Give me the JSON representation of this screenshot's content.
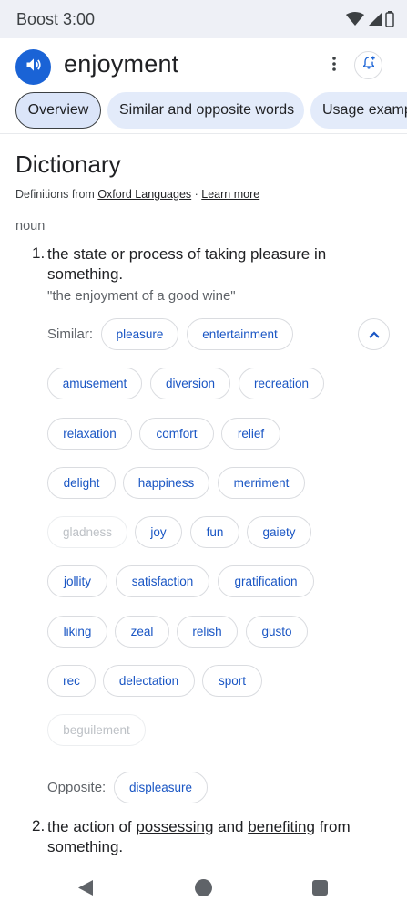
{
  "status_bar": {
    "carrier_time": "Boost 3:00",
    "icons": [
      "wifi-icon",
      "signal-icon",
      "battery-icon"
    ]
  },
  "header": {
    "word": "enjoyment",
    "speaker_icon": "speaker-icon",
    "more_icon": "more-vert-icon",
    "alert_icon": "bell-add-icon"
  },
  "tabs": [
    {
      "label": "Overview",
      "active": true
    },
    {
      "label": "Similar and opposite words",
      "active": false
    },
    {
      "label": "Usage examples",
      "active": false
    }
  ],
  "dictionary": {
    "heading": "Dictionary",
    "source_prefix": "Definitions from ",
    "source_link": "Oxford Languages",
    "separator": " · ",
    "learn_more": "Learn more",
    "part_of_speech": "noun"
  },
  "definition1": {
    "number": "1.",
    "text": "the state or process of taking pleasure in something.",
    "example": "\"the enjoyment of a good wine\"",
    "similar_label": "Similar:",
    "similar": [
      {
        "word": "pleasure",
        "enabled": true
      },
      {
        "word": "entertainment",
        "enabled": true
      },
      {
        "word": "amusement",
        "enabled": true
      },
      {
        "word": "diversion",
        "enabled": true
      },
      {
        "word": "recreation",
        "enabled": true
      },
      {
        "word": "relaxation",
        "enabled": true
      },
      {
        "word": "comfort",
        "enabled": true
      },
      {
        "word": "relief",
        "enabled": true
      },
      {
        "word": "delight",
        "enabled": true
      },
      {
        "word": "happiness",
        "enabled": true
      },
      {
        "word": "merriment",
        "enabled": true
      },
      {
        "word": "gladness",
        "enabled": false
      },
      {
        "word": "joy",
        "enabled": true
      },
      {
        "word": "fun",
        "enabled": true
      },
      {
        "word": "gaiety",
        "enabled": true
      },
      {
        "word": "jollity",
        "enabled": true
      },
      {
        "word": "satisfaction",
        "enabled": true
      },
      {
        "word": "gratification",
        "enabled": true
      },
      {
        "word": "liking",
        "enabled": true
      },
      {
        "word": "zeal",
        "enabled": true
      },
      {
        "word": "relish",
        "enabled": true
      },
      {
        "word": "gusto",
        "enabled": true
      },
      {
        "word": "rec",
        "enabled": true
      },
      {
        "word": "delectation",
        "enabled": true
      },
      {
        "word": "sport",
        "enabled": true
      },
      {
        "word": "beguilement",
        "enabled": false
      }
    ],
    "collapse_icon": "chevron-up-icon",
    "opposite_label": "Opposite:",
    "opposite": [
      "displeasure"
    ]
  },
  "definition2": {
    "number": "2.",
    "text_part1": "the action of ",
    "link1": "possessing",
    "text_part2": " and ",
    "link2": "benefiting",
    "text_part3": " from something."
  },
  "nav_bar": {
    "icons": [
      "back-icon",
      "home-icon",
      "recents-icon"
    ]
  },
  "colors": {
    "accent": "#1a63d6",
    "chip_text": "#1a56c4",
    "tab_bg": "#e3ebfa",
    "statusbar_bg": "#eef0f6"
  }
}
